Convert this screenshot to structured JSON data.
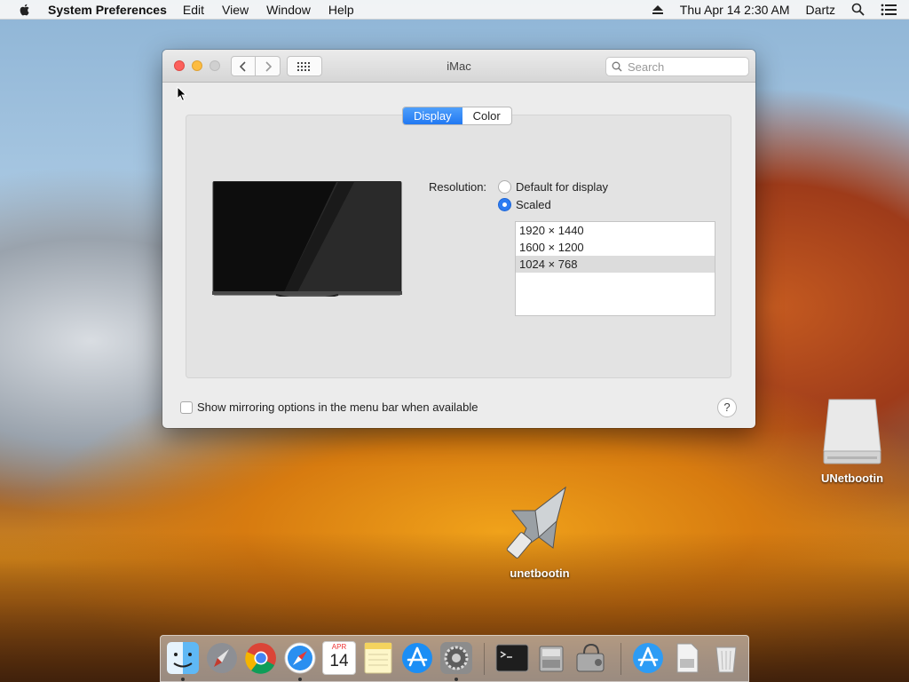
{
  "menubar": {
    "app_name": "System Preferences",
    "items": [
      "Edit",
      "View",
      "Window",
      "Help"
    ],
    "clock": "Thu Apr 14  2:30 AM",
    "user": "Dartz"
  },
  "window": {
    "title": "iMac",
    "search_placeholder": "Search",
    "tabs": [
      "Display",
      "Color"
    ],
    "active_tab": "Display",
    "resolution_label": "Resolution:",
    "options": {
      "default": "Default for display",
      "scaled": "Scaled",
      "selected": "Scaled"
    },
    "resolutions": [
      "1920 × 1440",
      "1600 × 1200",
      "1024 × 768"
    ],
    "selected_resolution": "1024 × 768",
    "mirroring_label": "Show mirroring options in the menu bar when available",
    "mirroring_checked": false,
    "help_label": "?"
  },
  "desktop": {
    "icons": [
      {
        "name": "UNetbootin",
        "kind": "drive"
      },
      {
        "name": "unetbootin",
        "kind": "app"
      }
    ]
  },
  "dock": {
    "apps": [
      "Finder",
      "Launchpad",
      "Chrome",
      "Safari",
      "Calendar",
      "Notes",
      "App Store",
      "System Preferences",
      "Terminal",
      "Disk Utility",
      "Disk Utility 2",
      "App Store Downloads",
      "Document",
      "Trash"
    ],
    "calendar_month": "APR",
    "calendar_day": "14"
  },
  "colors": {
    "accent": "#2c7bf2",
    "close": "#fc605c",
    "minimize": "#fdbc40"
  }
}
